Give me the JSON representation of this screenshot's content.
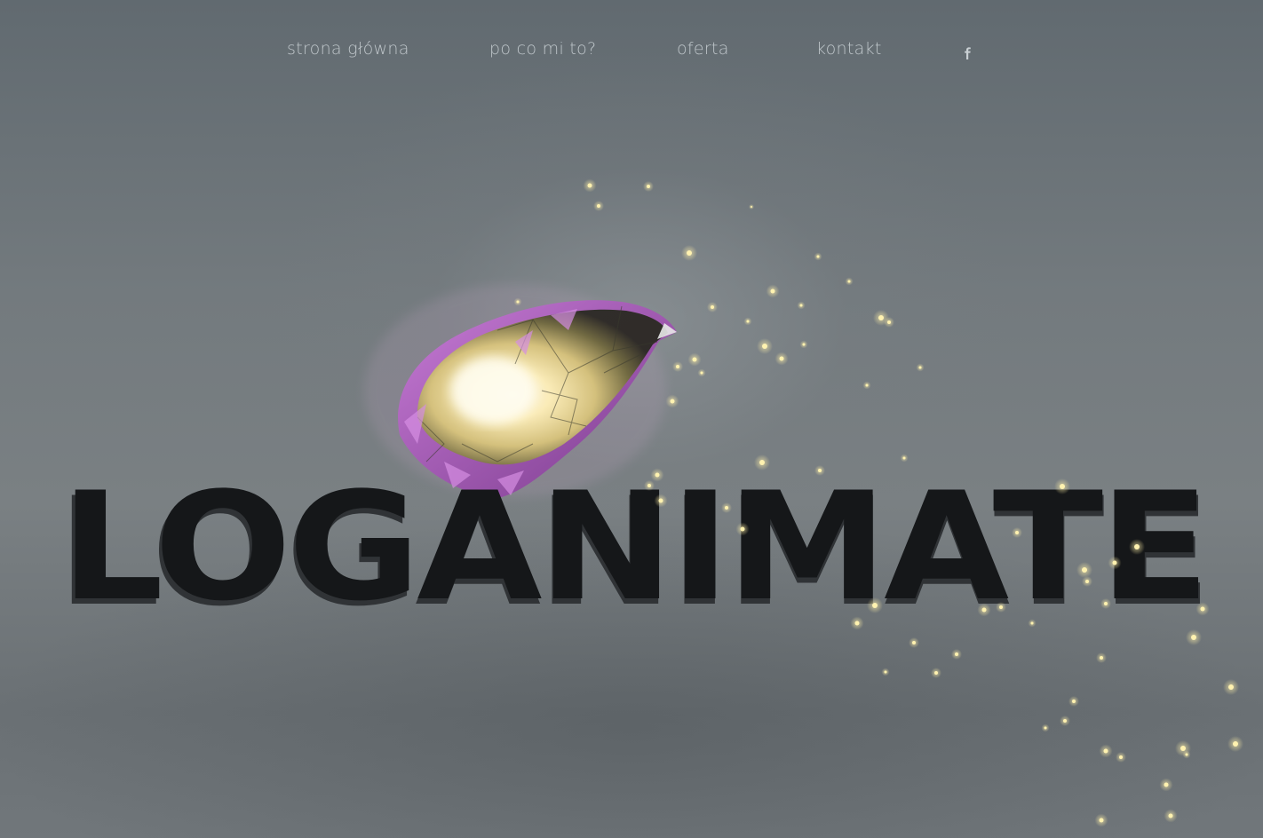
{
  "nav": {
    "items": [
      {
        "label": "strona główna"
      },
      {
        "label": "po co mi to?"
      },
      {
        "label": "oferta"
      },
      {
        "label": "kontakt"
      }
    ],
    "social_icon": "facebook-icon"
  },
  "hero": {
    "logo_text": "LOGANIMATE",
    "gem_icon": "crystal-gem",
    "colors": {
      "background": "#6b7276",
      "logo": "#151719",
      "gem_purple": "#b45cc4",
      "gem_glow": "#fff6c8",
      "sparkle": "#fff2b0"
    }
  }
}
